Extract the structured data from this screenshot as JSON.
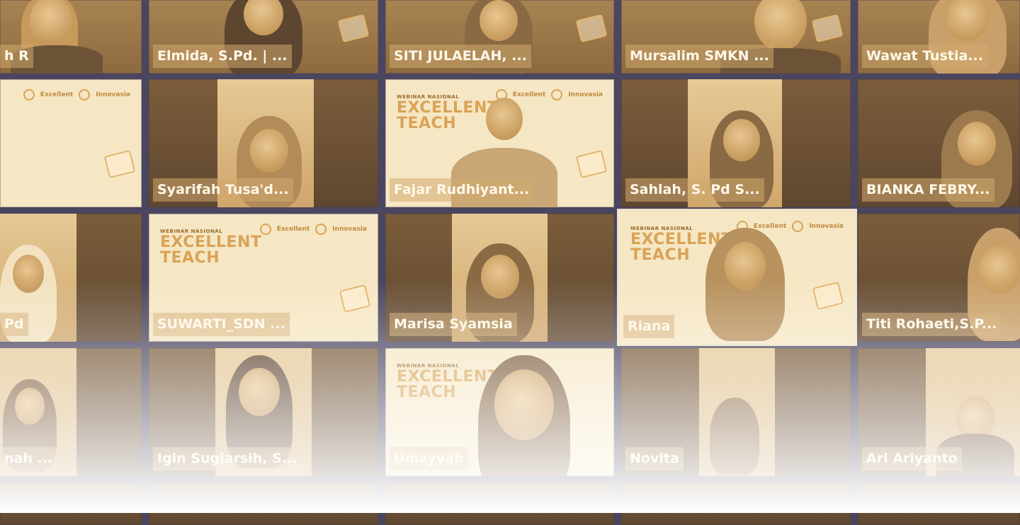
{
  "participants": [
    "h R",
    "Elmida, S.Pd. | ...",
    "SITI JULAELAH, ...",
    "Mursalim SMKN ...",
    "Wawat Tustia...",
    "",
    "Syarifah Tusa'd...",
    "Fajar Rudhiyant...",
    "Sahlah, S. Pd S...",
    "BIANKA FEBRY...",
    "Pd",
    "SUWARTI_SDN ...",
    "Marisa Syamsia",
    "Riana",
    "Titi Rohaeti,S.P...",
    "nah ...",
    "Igin Sugiarsih, S...",
    "Umayyah",
    "Novita",
    "Ari Ariyanto"
  ],
  "slide": {
    "label_small": "WEBINAR NASIONAL",
    "label_big_1": "EXCELLENT",
    "label_big_2": "TEACH",
    "logo_1": "Excellent",
    "logo_2": "Innovasia"
  },
  "colors": {
    "tile_tint": "#b68a4a",
    "grid_bg": "#4a4660",
    "active_border": "#efe3c8"
  }
}
